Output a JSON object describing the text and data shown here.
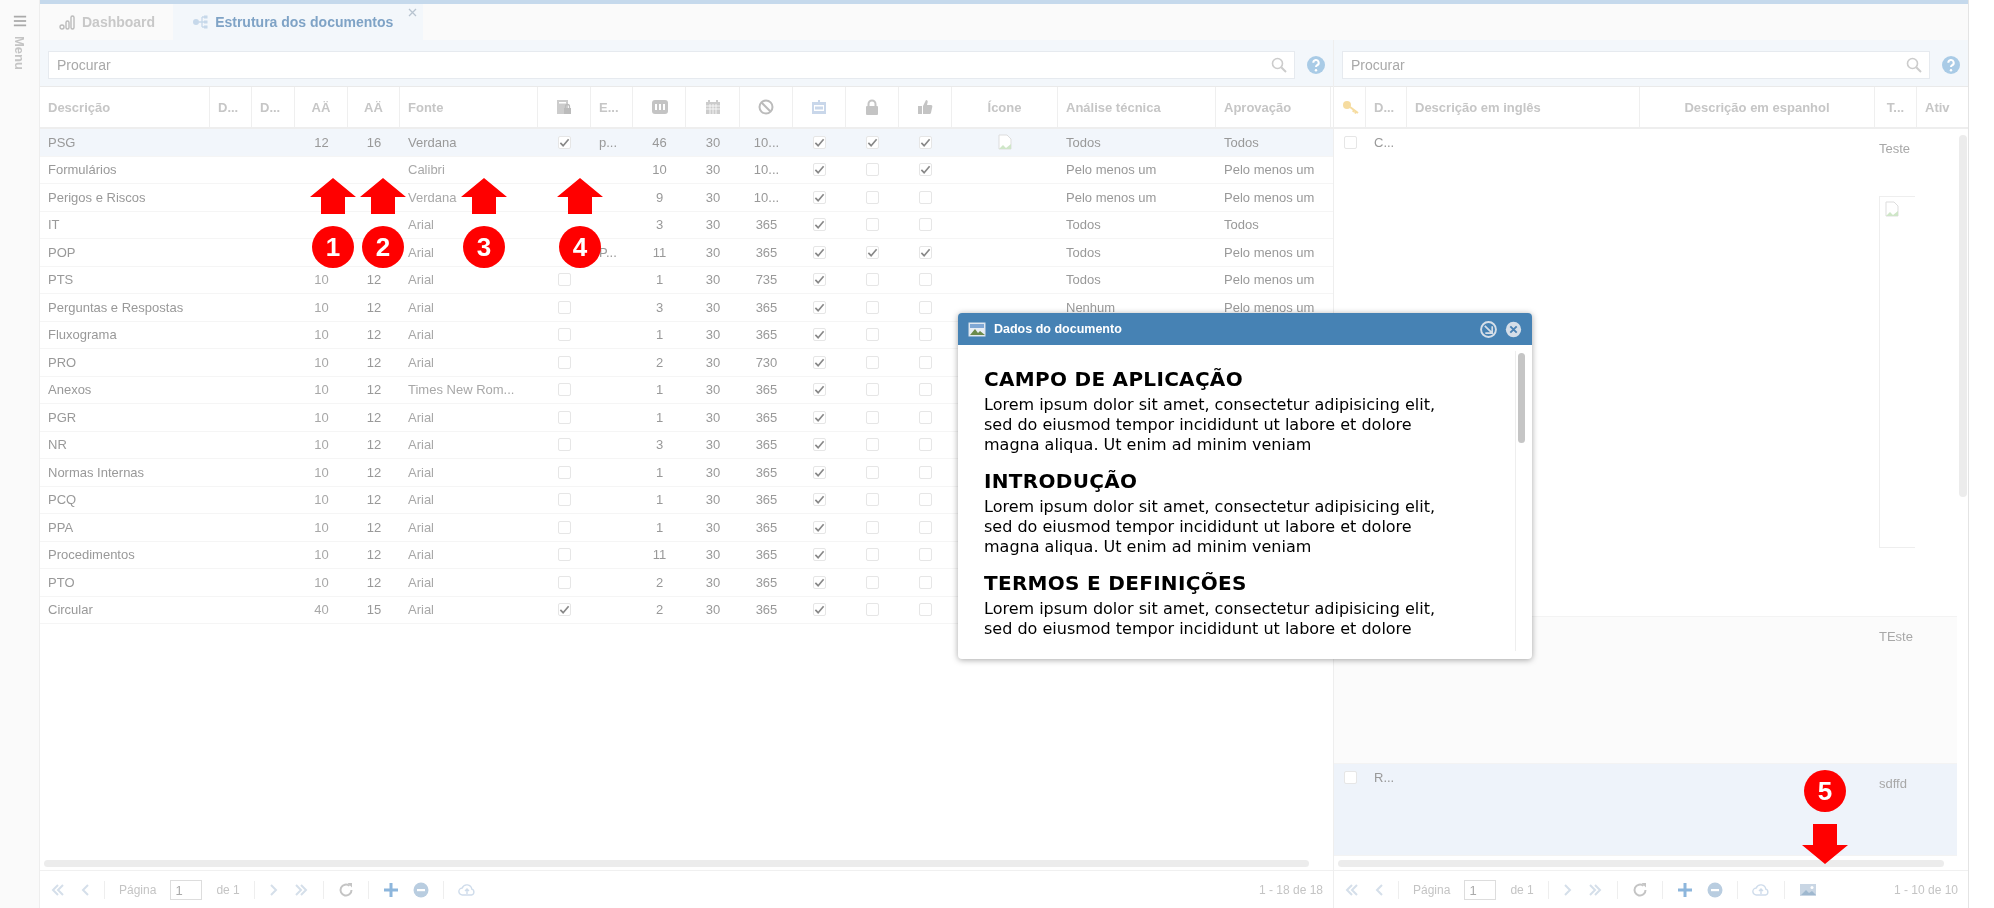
{
  "menu": {
    "label": "Menu"
  },
  "tabs": [
    {
      "label": "Dashboard",
      "selected": false
    },
    {
      "label": "Estrutura dos documentos",
      "selected": true
    }
  ],
  "documents": {
    "search": {
      "placeholder": "Procurar"
    },
    "columns": [
      {
        "kind": "text",
        "label": "Descrição"
      },
      {
        "kind": "text",
        "label": "D..."
      },
      {
        "kind": "text",
        "label": "D..."
      },
      {
        "kind": "text",
        "label": "AÄ"
      },
      {
        "kind": "text",
        "label": "AÄ"
      },
      {
        "kind": "text",
        "label": "Fonte"
      },
      {
        "kind": "icon"
      },
      {
        "kind": "text",
        "label": "E..."
      },
      {
        "kind": "icon"
      },
      {
        "kind": "icon"
      },
      {
        "kind": "icon"
      },
      {
        "kind": "icon"
      },
      {
        "kind": "icon"
      },
      {
        "kind": "icon"
      },
      {
        "kind": "text",
        "label": "Ícone"
      },
      {
        "kind": "text",
        "label": "Análise técnica"
      },
      {
        "kind": "text",
        "label": "Aprovação"
      }
    ],
    "rows": [
      {
        "description": "PSG",
        "size": "12",
        "title_size": "16",
        "font": "Verdana",
        "doc_locked": true,
        "e": "p...",
        "count": "46",
        "days": "30",
        "validity": "10...",
        "calendar": true,
        "locked": true,
        "approved": true,
        "image": true,
        "analysis": "Todos",
        "approval": "Todos",
        "selected": true
      },
      {
        "description": "Formulários",
        "font": "Calibri",
        "count": "10",
        "days": "30",
        "validity": "10...",
        "calendar": true,
        "locked": false,
        "approved": true,
        "analysis": "Pelo menos um",
        "approval": "Pelo menos um",
        "selected": false
      },
      {
        "description": "Perigos e Riscos",
        "font": "Verdana",
        "count": "9",
        "days": "30",
        "validity": "10...",
        "calendar": true,
        "locked": false,
        "approved": false,
        "analysis": "Pelo menos um",
        "approval": "Pelo menos um",
        "selected": false
      },
      {
        "description": "IT",
        "font": "Arial",
        "count": "3",
        "days": "30",
        "validity": "365",
        "calendar": true,
        "locked": false,
        "approved": false,
        "analysis": "Todos",
        "approval": "Todos",
        "selected": false
      },
      {
        "description": "POP",
        "font": "Arial",
        "e": "P...",
        "count": "11",
        "days": "30",
        "validity": "365",
        "calendar": true,
        "locked": true,
        "approved": true,
        "analysis": "Todos",
        "approval": "Pelo menos um",
        "selected": false
      },
      {
        "description": "PTS",
        "size": "10",
        "title_size": "12",
        "font": "Arial",
        "doc_locked": false,
        "count": "1",
        "days": "30",
        "validity": "735",
        "calendar": true,
        "locked": false,
        "approved": false,
        "analysis": "Todos",
        "approval": "Pelo menos um",
        "selected": false
      },
      {
        "description": "Perguntas e Respostas",
        "size": "10",
        "title_size": "12",
        "font": "Arial",
        "doc_locked": false,
        "count": "3",
        "days": "30",
        "validity": "365",
        "calendar": true,
        "locked": false,
        "approved": false,
        "analysis": "Nenhum",
        "approval": "Pelo menos um",
        "selected": false
      },
      {
        "description": "Fluxograma",
        "size": "10",
        "title_size": "12",
        "font": "Arial",
        "doc_locked": false,
        "count": "1",
        "days": "30",
        "validity": "365",
        "calendar": true,
        "locked": false,
        "approved": false,
        "selected": false
      },
      {
        "description": "PRO",
        "size": "10",
        "title_size": "12",
        "font": "Arial",
        "doc_locked": false,
        "count": "2",
        "days": "30",
        "validity": "730",
        "calendar": true,
        "locked": false,
        "approved": false,
        "selected": false
      },
      {
        "description": "Anexos",
        "size": "10",
        "title_size": "12",
        "font": "Times New Rom...",
        "doc_locked": false,
        "count": "1",
        "days": "30",
        "validity": "365",
        "calendar": true,
        "locked": false,
        "approved": false,
        "selected": false
      },
      {
        "description": "PGR",
        "size": "10",
        "title_size": "12",
        "font": "Arial",
        "doc_locked": false,
        "count": "1",
        "days": "30",
        "validity": "365",
        "calendar": true,
        "locked": false,
        "approved": false,
        "selected": false
      },
      {
        "description": "NR",
        "size": "10",
        "title_size": "12",
        "font": "Arial",
        "doc_locked": false,
        "count": "3",
        "days": "30",
        "validity": "365",
        "calendar": true,
        "locked": false,
        "approved": false,
        "selected": false
      },
      {
        "description": "Normas Internas",
        "size": "10",
        "title_size": "12",
        "font": "Arial",
        "doc_locked": false,
        "count": "1",
        "days": "30",
        "validity": "365",
        "calendar": true,
        "locked": false,
        "approved": false,
        "selected": false
      },
      {
        "description": "PCQ",
        "size": "10",
        "title_size": "12",
        "font": "Arial",
        "doc_locked": false,
        "count": "1",
        "days": "30",
        "validity": "365",
        "calendar": true,
        "locked": false,
        "approved": false,
        "selected": false
      },
      {
        "description": "PPA",
        "size": "10",
        "title_size": "12",
        "font": "Arial",
        "doc_locked": false,
        "count": "1",
        "days": "30",
        "validity": "365",
        "calendar": true,
        "locked": false,
        "approved": false,
        "selected": false
      },
      {
        "description": "Procedimentos",
        "size": "10",
        "title_size": "12",
        "font": "Arial",
        "doc_locked": false,
        "count": "11",
        "days": "30",
        "validity": "365",
        "calendar": true,
        "locked": false,
        "approved": false,
        "selected": false
      },
      {
        "description": "PTO",
        "size": "10",
        "title_size": "12",
        "font": "Arial",
        "doc_locked": false,
        "count": "2",
        "days": "30",
        "validity": "365",
        "calendar": true,
        "locked": false,
        "approved": false,
        "selected": false
      },
      {
        "description": "Circular",
        "size": "40",
        "title_size": "15",
        "font": "Arial",
        "doc_locked": true,
        "count": "2",
        "days": "30",
        "validity": "365",
        "calendar": true,
        "locked": false,
        "approved": false,
        "selected": false
      }
    ],
    "pager": {
      "page_label": "Página",
      "page": "1",
      "of": "de 1",
      "range": "1 - 18 de 18"
    }
  },
  "details": {
    "search": {
      "placeholder": "Procurar"
    },
    "columns": [
      {
        "kind": "icon"
      },
      {
        "kind": "text",
        "label": "D..."
      },
      {
        "kind": "text",
        "label": "Descrição em inglês"
      },
      {
        "kind": "text",
        "label": "Descrição em espanhol"
      },
      {
        "kind": "text",
        "label": "T..."
      },
      {
        "kind": "text",
        "label": "Ativ"
      }
    ],
    "rows": [
      {
        "checked": false,
        "d": "C...",
        "t": "Teste",
        "image": true,
        "selected": false
      },
      {
        "t": "TEste",
        "selected": false
      },
      {
        "checked": false,
        "d": "R...",
        "t": "sdffd",
        "selected": true
      }
    ],
    "pager": {
      "page_label": "Página",
      "page": "1",
      "of": "de 1",
      "range": "1 - 10 de 10"
    }
  },
  "dialog": {
    "title": "Dados do documento",
    "sections": [
      {
        "heading": "CAMPO DE APLICAÇÃO",
        "text": "Lorem ipsum dolor sit amet, consectetur adipisicing elit, sed do eiusmod tempor incididunt ut labore et dolore magna aliqua. Ut enim ad minim veniam"
      },
      {
        "heading": "INTRODUÇÃO",
        "text": "Lorem ipsum dolor sit amet, consectetur adipisicing elit, sed do eiusmod tempor incididunt ut labore et dolore magna aliqua. Ut enim ad minim veniam"
      },
      {
        "heading": "TERMOS E DEFINIÇÕES",
        "text": "Lorem ipsum dolor sit amet, consectetur adipisicing elit, sed do eiusmod tempor incididunt ut labore et dolore"
      }
    ]
  },
  "annotations": [
    {
      "number": "1",
      "kind": "up"
    },
    {
      "number": "2",
      "kind": "up"
    },
    {
      "number": "3",
      "kind": "up"
    },
    {
      "number": "4",
      "kind": "up"
    },
    {
      "number": "5",
      "kind": "down"
    }
  ]
}
